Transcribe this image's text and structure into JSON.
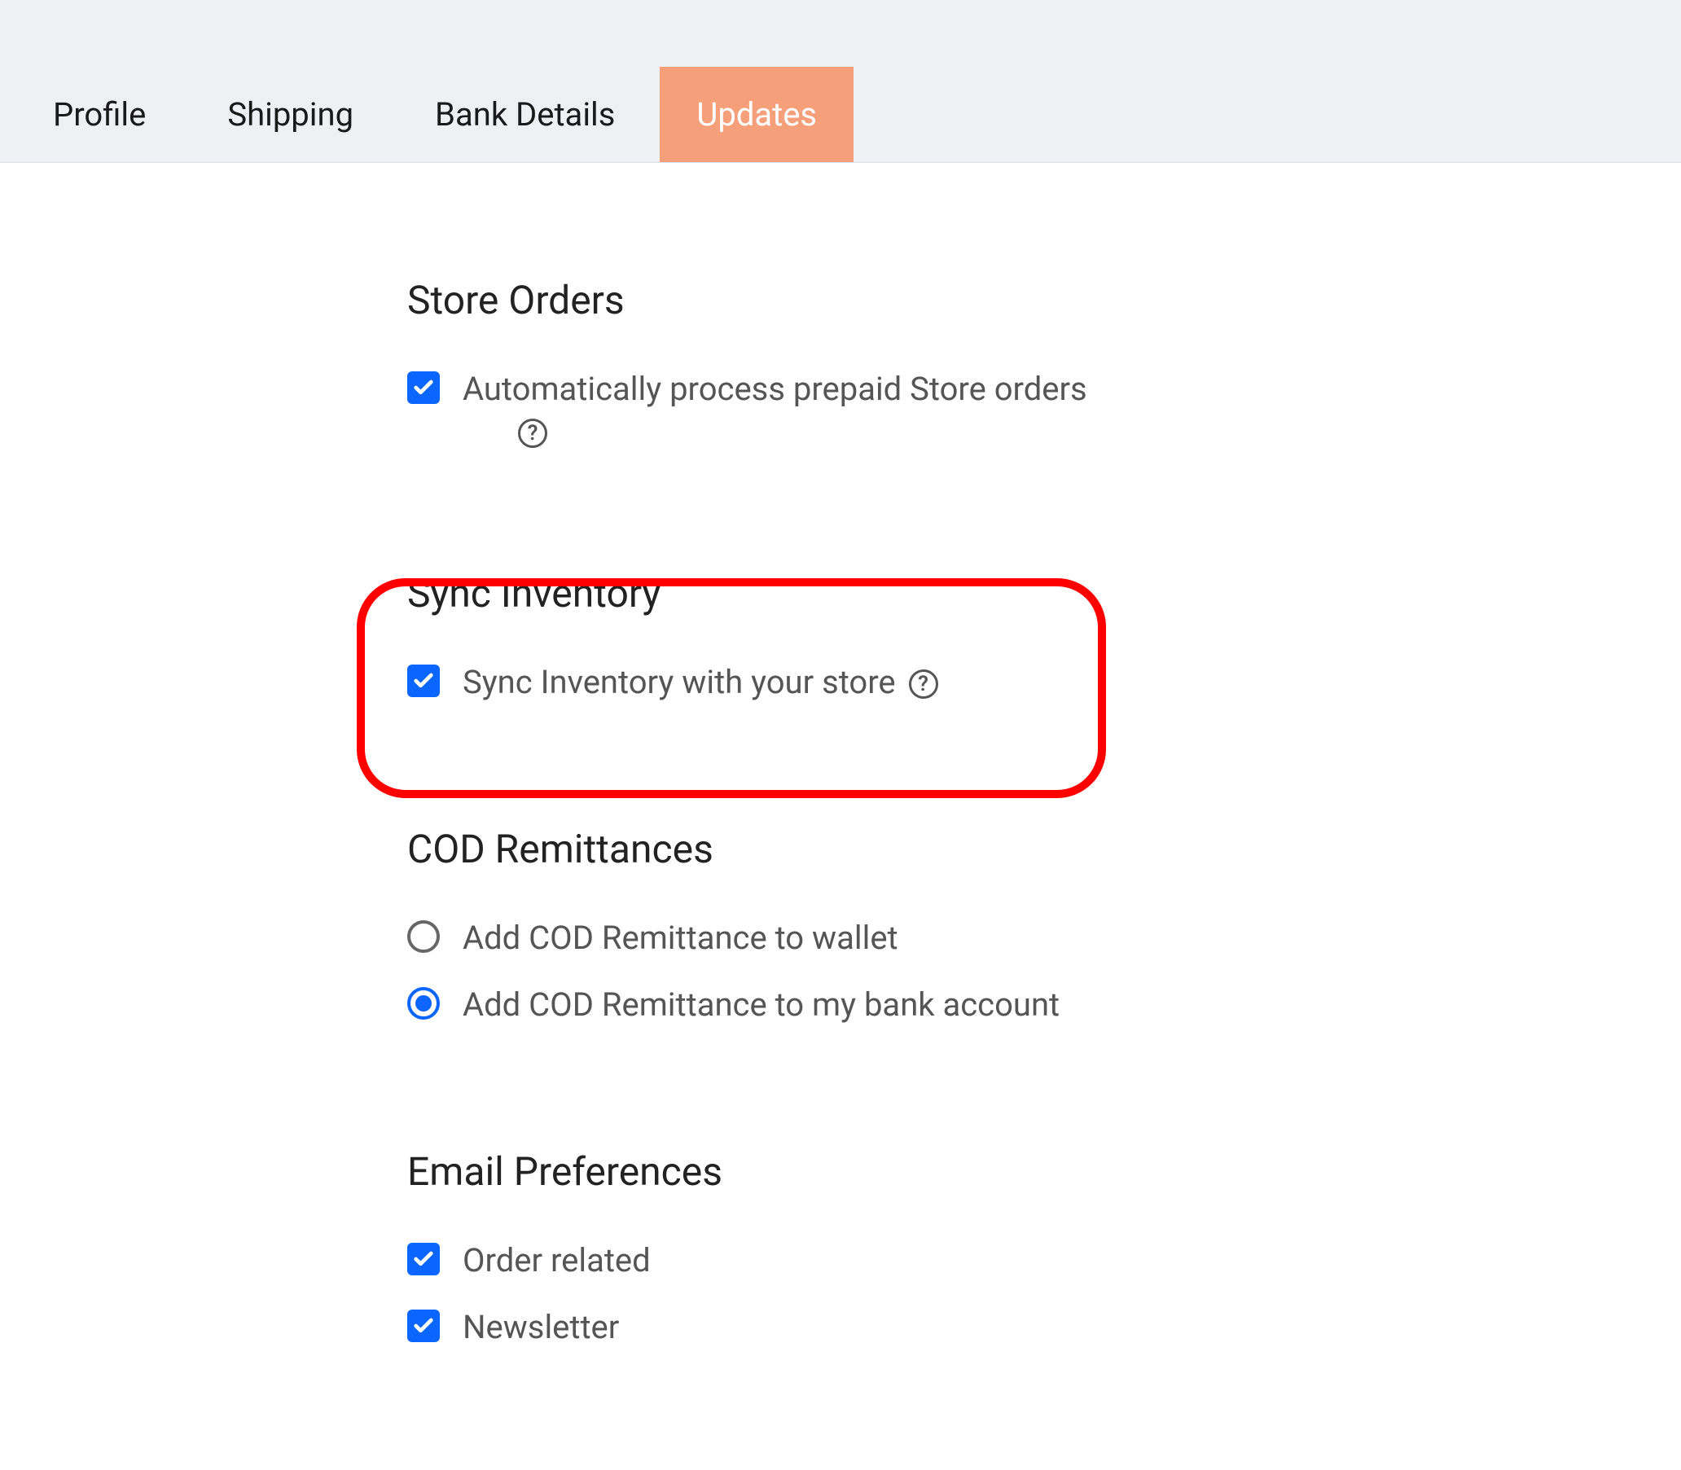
{
  "tabs": {
    "profile": "Profile",
    "shipping": "Shipping",
    "bank": "Bank Details",
    "updates": "Updates"
  },
  "sections": {
    "storeOrders": {
      "title": "Store Orders",
      "option1": "Automatically process prepaid Store orders"
    },
    "syncInventory": {
      "title": "Sync Inventory",
      "option1": "Sync Inventory with your store"
    },
    "cod": {
      "title": "COD Remittances",
      "option1": "Add COD Remittance to wallet",
      "option2": "Add COD Remittance to my bank account"
    },
    "email": {
      "title": "Email Preferences",
      "option1": "Order related",
      "option2": "Newsletter"
    }
  },
  "helpGlyph": "?"
}
